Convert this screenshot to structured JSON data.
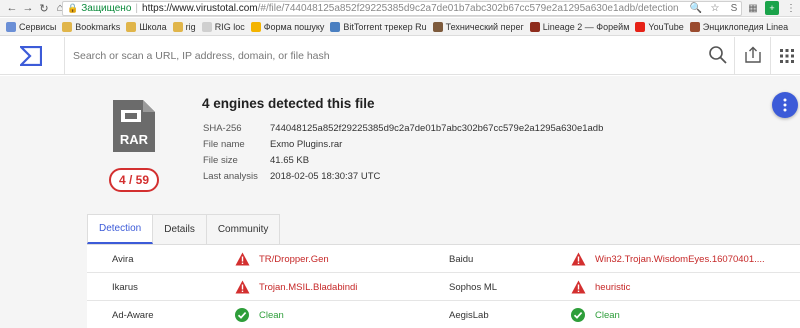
{
  "browser": {
    "secure_label": "Защищено",
    "url_host": "https://www.virustotal.com",
    "url_path": "/#/file/744048125a852f29225385d9c2a7de01b7abc302b67cc579e2a1295a630e1adb/detection"
  },
  "bookmarks": [
    {
      "label": "Сервисы",
      "icon": "apps-icon",
      "color": "#6b8fd6"
    },
    {
      "label": "Bookmarks",
      "icon": "folder-icon",
      "color": "#e0b54a"
    },
    {
      "label": "Школа",
      "icon": "folder-icon",
      "color": "#e0b54a"
    },
    {
      "label": "rig",
      "icon": "folder-icon",
      "color": "#e0b54a"
    },
    {
      "label": "RIG loc",
      "icon": "page-icon",
      "color": "#cfcfcf"
    },
    {
      "label": "Форма пошуку",
      "icon": "location-icon",
      "color": "#f4b400"
    },
    {
      "label": "BitTorrent трекер Ru",
      "icon": "torrent-icon",
      "color": "#4a7fc1"
    },
    {
      "label": "Технический перег",
      "icon": "tech-icon",
      "color": "#7d5a3c"
    },
    {
      "label": "Lineage 2 — Форейм",
      "icon": "game-icon",
      "color": "#8e2c1c"
    },
    {
      "label": "YouTube",
      "icon": "youtube-icon",
      "color": "#e62117"
    },
    {
      "label": "Энциклопедия Linea",
      "icon": "book-icon",
      "color": "#9a4b2f"
    }
  ],
  "search": {
    "placeholder": "Search or scan a URL, IP address, domain, or file hash"
  },
  "file": {
    "icon_label": "RAR",
    "score": "4 / 59",
    "title": "4 engines detected this file",
    "meta": [
      {
        "key": "SHA-256",
        "value": "744048125a852f29225385d9c2a7de01b7abc302b67cc579e2a1295a630e1adb"
      },
      {
        "key": "File name",
        "value": "Exmo Plugins.rar"
      },
      {
        "key": "File size",
        "value": "41.65 KB"
      },
      {
        "key": "Last analysis",
        "value": "2018-02-05 18:30:37 UTC"
      }
    ]
  },
  "tabs": [
    {
      "label": "Detection",
      "active": true
    },
    {
      "label": "Details",
      "active": false
    },
    {
      "label": "Community",
      "active": false
    }
  ],
  "results": [
    {
      "engine": "Avira",
      "status": "malicious",
      "result": "TR/Dropper.Gen",
      "engine2": "Baidu",
      "status2": "malicious",
      "result2": "Win32.Trojan.WisdomEyes.16070401...."
    },
    {
      "engine": "Ikarus",
      "status": "malicious",
      "result": "Trojan.MSIL.Bladabindi",
      "engine2": "Sophos ML",
      "status2": "malicious",
      "result2": "heuristic"
    },
    {
      "engine": "Ad-Aware",
      "status": "clean",
      "result": "Clean",
      "engine2": "AegisLab",
      "status2": "clean",
      "result2": "Clean"
    }
  ],
  "colors": {
    "accent": "#3c5bd8",
    "malicious": "#d32f2f",
    "clean": "#2e9e3a"
  }
}
